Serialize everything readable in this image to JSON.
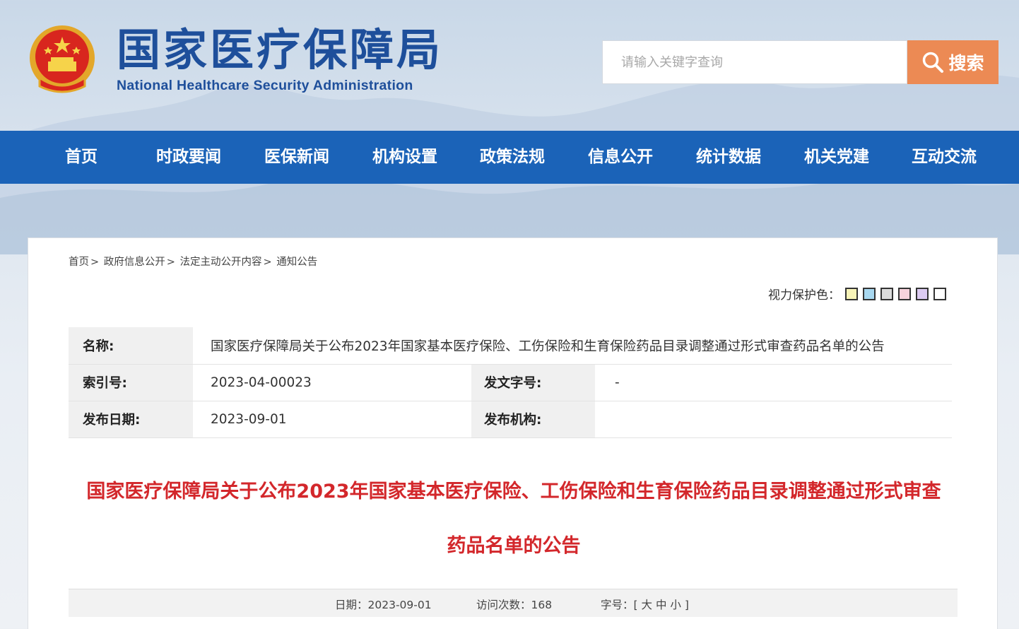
{
  "header": {
    "logo_cn": "国家医疗保障局",
    "logo_en": "National Healthcare Security Administration",
    "search_placeholder": "请输入关键字查询",
    "search_label": "搜索"
  },
  "nav": [
    "首页",
    "时政要闻",
    "医保新闻",
    "机构设置",
    "政策法规",
    "信息公开",
    "统计数据",
    "机关党建",
    "互动交流"
  ],
  "breadcrumb": [
    "首页",
    "政府信息公开",
    "法定主动公开内容",
    "通知公告"
  ],
  "eye_protect": {
    "label": "视力保护色：",
    "colors": [
      "#f8f4b8",
      "#a8d8f0",
      "#dcdcdc",
      "#f8d2dc",
      "#dccbf2",
      "#ffffff"
    ]
  },
  "info": {
    "name_label": "名称:",
    "name_value": "国家医疗保障局关于公布2023年国家基本医疗保险、工伤保险和生育保险药品目录调整通过形式审查药品名单的公告",
    "index_label": "索引号:",
    "index_value": "2023-04-00023",
    "docno_label": "发文字号:",
    "docno_value": "-",
    "date_label": "发布日期:",
    "date_value": "2023-09-01",
    "org_label": "发布机构:",
    "org_value": ""
  },
  "article": {
    "title_line1": "国家医疗保障局关于公布2023年国家基本医疗保险、工伤保险和生育保险药品目录调整通过形式审查",
    "title_line2": "药品名单的公告"
  },
  "meta": {
    "date_label": "日期：",
    "date_value": "2023-09-01",
    "visits_label": "访问次数：",
    "visits_value": "168",
    "font_label": "字号：",
    "bracket_open": "[",
    "font_large": "大",
    "font_medium": "中",
    "font_small": "小",
    "bracket_close": "]"
  },
  "colors": {
    "nav_bg": "#1b63b8",
    "search_btn": "#ec8a54",
    "title_red": "#d3272b",
    "logo_blue": "#1e4f9b"
  }
}
